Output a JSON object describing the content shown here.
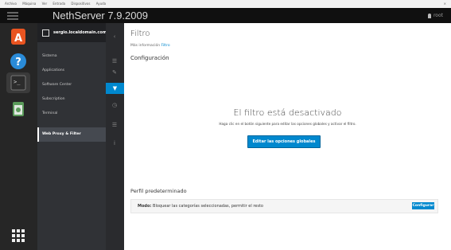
{
  "window_menu": {
    "items": [
      "Archivo",
      "Máquina",
      "Ver",
      "Entrada",
      "Dispositivos",
      "Ayuda"
    ],
    "close": "×"
  },
  "topbar": {
    "title": "NethServer 7.9.2009",
    "user": "root"
  },
  "dock": {
    "icons": [
      "ubuntu-software-icon",
      "help-icon",
      "terminal-icon",
      "trash-icon",
      "show-applications-icon"
    ]
  },
  "sidebar": {
    "hostname": "sergio.localdomain.com",
    "items": [
      {
        "label": "Sistema"
      },
      {
        "label": "Applications"
      },
      {
        "label": "Software Center"
      },
      {
        "label": "Subscription"
      },
      {
        "label": "Terminal"
      },
      {
        "label": "Web Proxy & Filter"
      }
    ]
  },
  "main": {
    "title": "Filtro",
    "info_prefix": "Más información",
    "info_link": "Filtro",
    "section_config": "Configuración",
    "disabled_title": "El filtro está desactivado",
    "disabled_hint": "Haga clic en el botón siguiente para editar las opciones globales y activar el filtro.",
    "edit_button": "Editar las opciones globales",
    "profile_title": "Perfil predeterminado",
    "mode_label": "Modo:",
    "mode_value": "Bloquear las categorías seleccionadas, permitir el resto",
    "configure_button": "Configurar"
  },
  "colors": {
    "accent": "#0088ce",
    "sidebar": "#303236",
    "dock": "#262626"
  }
}
